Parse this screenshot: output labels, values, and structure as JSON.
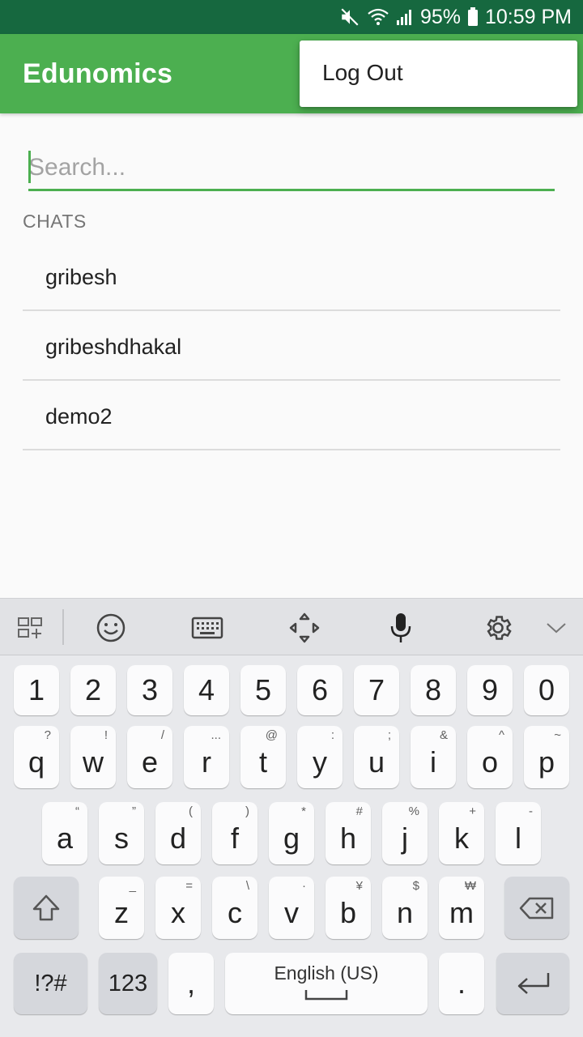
{
  "status_bar": {
    "battery": "95%",
    "time": "10:59 PM"
  },
  "app_bar": {
    "title": "Edunomics"
  },
  "overflow_menu": {
    "items": [
      {
        "label": "Log Out"
      }
    ]
  },
  "search": {
    "placeholder": "Search...",
    "value": ""
  },
  "chats": {
    "section_label": "CHATS",
    "items": [
      {
        "name": "gribesh"
      },
      {
        "name": "gribeshdhakal"
      },
      {
        "name": "demo2"
      }
    ]
  },
  "keyboard": {
    "toolbar_icons": [
      "apps-icon",
      "emoji-icon",
      "keyboard-icon",
      "cursor-move-icon",
      "microphone-icon",
      "gear-icon",
      "chevron-down-icon"
    ],
    "number_row": [
      "1",
      "2",
      "3",
      "4",
      "5",
      "6",
      "7",
      "8",
      "9",
      "0"
    ],
    "row1": [
      {
        "k": "q",
        "s": "?"
      },
      {
        "k": "w",
        "s": "!"
      },
      {
        "k": "e",
        "s": "/"
      },
      {
        "k": "r",
        "s": "..."
      },
      {
        "k": "t",
        "s": "@"
      },
      {
        "k": "y",
        "s": ":"
      },
      {
        "k": "u",
        "s": ";"
      },
      {
        "k": "i",
        "s": "&"
      },
      {
        "k": "o",
        "s": "^"
      },
      {
        "k": "p",
        "s": "~"
      }
    ],
    "row2": [
      {
        "k": "a",
        "s": "“"
      },
      {
        "k": "s",
        "s": "”"
      },
      {
        "k": "d",
        "s": "("
      },
      {
        "k": "f",
        "s": ")"
      },
      {
        "k": "g",
        "s": "*"
      },
      {
        "k": "h",
        "s": "#"
      },
      {
        "k": "j",
        "s": "%"
      },
      {
        "k": "k",
        "s": "+"
      },
      {
        "k": "l",
        "s": "-"
      }
    ],
    "row3": [
      {
        "k": "z",
        "s": "_"
      },
      {
        "k": "x",
        "s": "="
      },
      {
        "k": "c",
        "s": "\\"
      },
      {
        "k": "v",
        "s": "·"
      },
      {
        "k": "b",
        "s": "¥"
      },
      {
        "k": "n",
        "s": "$"
      },
      {
        "k": "m",
        "s": "₩"
      }
    ],
    "symbols_label": "!?#",
    "numbers_label": "123",
    "comma": ",",
    "space_label": "English (US)",
    "period": "."
  },
  "colors": {
    "status_bar": "#16683f",
    "app_bar": "#4caf50",
    "accent": "#4caf50"
  }
}
